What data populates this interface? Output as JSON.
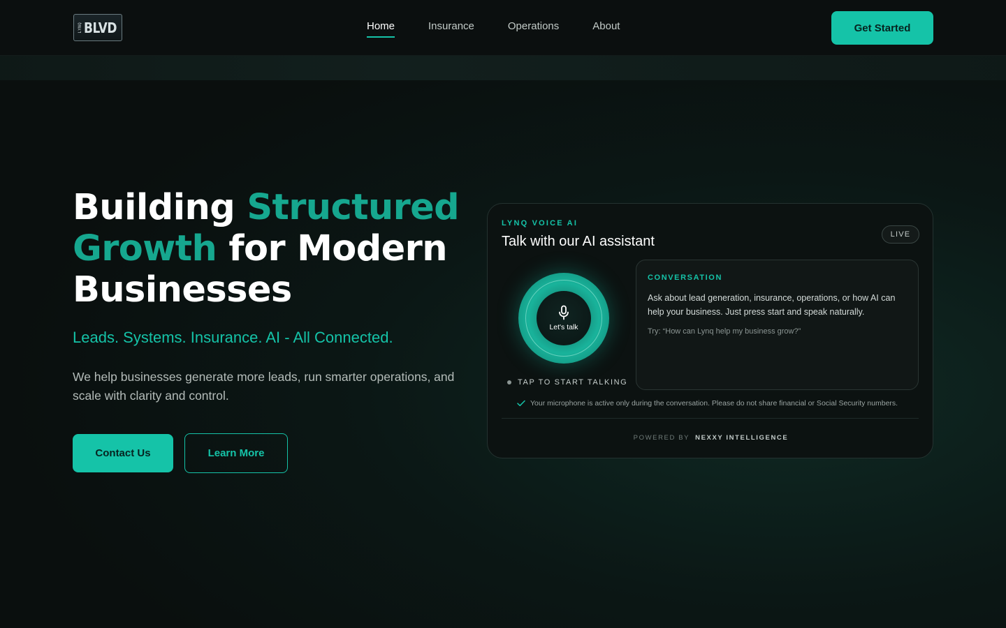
{
  "header": {
    "logo_small": "LYNQ",
    "logo_main": "BLVD",
    "nav": [
      {
        "label": "Home",
        "active": true
      },
      {
        "label": "Insurance",
        "active": false
      },
      {
        "label": "Operations",
        "active": false
      },
      {
        "label": "About",
        "active": false
      }
    ],
    "cta_label": "Get Started"
  },
  "hero": {
    "title_part1": "Building ",
    "title_accent1": "Structured Growth",
    "title_part2": " for Modern Businesses",
    "tagline": "Leads. Systems. Insurance. AI - All Connected.",
    "description": "We help businesses generate more leads, run smarter operations, and scale with clarity and control.",
    "primary_button": "Contact Us",
    "secondary_button": "Learn More"
  },
  "voice_card": {
    "eyebrow": "LYNQ VOICE AI",
    "title": "Talk with our AI assistant",
    "badge": "LIVE",
    "orb_label": "Let's talk",
    "tap_label": "TAP TO START TALKING",
    "conversation": {
      "eyebrow": "CONVERSATION",
      "text": "Ask about lead generation, insurance, operations, or how AI can help your business. Just press start and speak naturally.",
      "try": "Try: “How can Lynq help my business grow?”"
    },
    "notice": "Your microphone is active only during the conversation. Please do not share financial or Social Security numbers.",
    "powered_by_label": "POWERED BY",
    "powered_by_brand": "NEXXY INTELLIGENCE"
  },
  "colors": {
    "accent": "#15c3a8",
    "accent_dark": "#16a78f",
    "background": "#0a0f0e",
    "card_background": "#0c1211"
  },
  "icons": [
    "microphone-icon",
    "check-icon"
  ]
}
